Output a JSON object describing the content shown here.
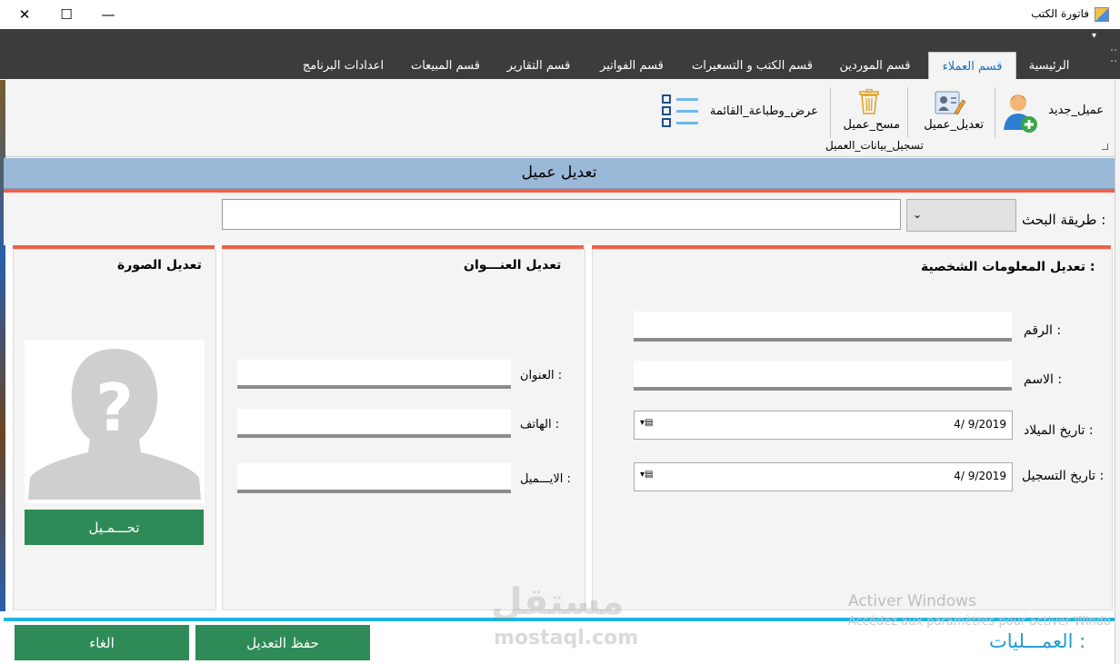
{
  "window": {
    "title": "فاتورة الكتب",
    "minimize_glyph": "—",
    "maximize_glyph": "☐",
    "close_glyph": "✕",
    "menu_arrow": "▾"
  },
  "tabs": [
    {
      "label": "الرئيسية"
    },
    {
      "label": "قسم العملاء",
      "active": true
    },
    {
      "label": "قسم الموردين"
    },
    {
      "label": "قسم الكتب و التسعيرات"
    },
    {
      "label": "قسم الفواتير"
    },
    {
      "label": "قسم التقارير"
    },
    {
      "label": "قسم المبيعات"
    },
    {
      "label": "اعدادات البرنامج"
    }
  ],
  "ribbon": {
    "new_client": "عميل_جديد",
    "edit_client": "تعديل_عميل",
    "delete_client": "مسح_عميل",
    "view_print": "عرض_وطباعة_القائمة",
    "group_label": "تسجيل_بيانات_العميل",
    "icons": {
      "new_client": "user-add-icon",
      "edit_client": "user-edit-icon",
      "delete_client": "trash-icon",
      "view_print": "list-icon"
    }
  },
  "form": {
    "header": "تعديل عميل",
    "search_label": "طريقة البحث :",
    "search_value": "",
    "search_method_selected": "",
    "personal": {
      "title": "تعديل المعلومات الشخصية :",
      "number_label": "الرقم :",
      "name_label": "الاسم :",
      "birth_label": "تاريخ الميلاد :",
      "birth_value": "4/ 9/2019",
      "reg_label": "تاريخ التسجيل :",
      "reg_value": "4/ 9/2019"
    },
    "address": {
      "title": "تعديل العنـــوان",
      "address_label": "العنوان :",
      "phone_label": "الهاتف :",
      "email_label": "الايـــميل :"
    },
    "photo": {
      "title": "تعديل الصورة",
      "upload_button": "تحـــمـيل"
    },
    "operations_label": "العمـــليات :",
    "save_button": "حفظ التعديل",
    "cancel_button": "الغاء"
  },
  "watermark": {
    "activate_title": "Activer Windows",
    "activate_sub": "Accédez aux paramètres pour activer Windo",
    "brand_ar": "مستقل",
    "brand_en": "mostaql.com"
  },
  "colors": {
    "accent_orange": "#f06048",
    "header_blue": "#9ab8d8",
    "green_button": "#2e8b57",
    "cyan_line": "#1eb3e0",
    "tab_active_text": "#1e6fb8"
  }
}
